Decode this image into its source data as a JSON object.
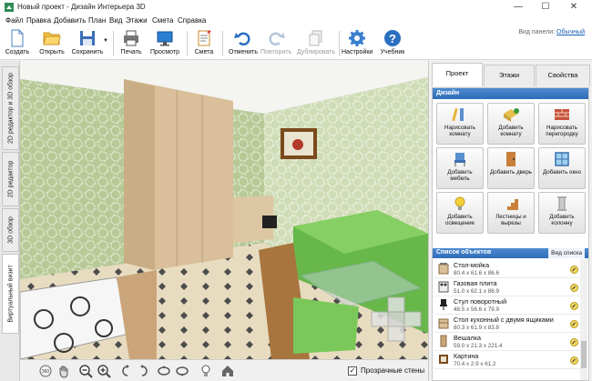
{
  "window": {
    "title": "Новый проект - Дизайн Интерьера 3D",
    "minimize": "—",
    "maximize": "☐",
    "close": "✕"
  },
  "menu": [
    "Файл",
    "Правка",
    "Добавить",
    "План",
    "Вид",
    "Этажи",
    "Смета",
    "Справка"
  ],
  "toolbar": {
    "buttons": [
      {
        "label": "Создать",
        "icon": "new-document-icon"
      },
      {
        "label": "Открыть",
        "icon": "folder-open-icon"
      },
      {
        "label": "Сохранить",
        "icon": "floppy-save-icon"
      },
      {
        "label": "Печать",
        "icon": "printer-icon"
      },
      {
        "label": "Просмотр",
        "icon": "monitor-preview-icon"
      },
      {
        "label": "Смета",
        "icon": "estimate-notepad-icon"
      },
      {
        "label": "Отменить",
        "icon": "undo-icon"
      },
      {
        "label": "Повторить",
        "icon": "redo-icon",
        "disabled": true
      },
      {
        "label": "Дублировать",
        "icon": "duplicate-icon",
        "disabled": true
      },
      {
        "label": "Настройки",
        "icon": "gear-icon"
      },
      {
        "label": "Учебник",
        "icon": "help-icon"
      }
    ],
    "view_panel_label": "Вид панели:",
    "view_panel_value": "Обычный"
  },
  "left_tabs": [
    "2D редактор и 3D обзор",
    "2D редактор",
    "3D обзор",
    "Виртуальный визит"
  ],
  "right_panel": {
    "tabs": [
      "Проект",
      "Этажи",
      "Свойства"
    ],
    "design_header": "Дизайн",
    "design_buttons": [
      {
        "label": "Нарисовать комнату",
        "icon": "pencil-ruler-icon"
      },
      {
        "label": "Добавить комнату",
        "icon": "add-room-icon"
      },
      {
        "label": "Нарисовать перегородку",
        "icon": "brick-wall-icon"
      },
      {
        "label": "Добавить мебель",
        "icon": "chair-icon"
      },
      {
        "label": "Добавить дверь",
        "icon": "door-icon"
      },
      {
        "label": "Добавить окно",
        "icon": "window-icon"
      },
      {
        "label": "Добавить освещение",
        "icon": "lightbulb-icon"
      },
      {
        "label": "Лестницы и вырезы",
        "icon": "stairs-icon"
      },
      {
        "label": "Добавить колонну",
        "icon": "column-icon"
      }
    ],
    "objects_header": "Список объектов",
    "objects_view_label": "Вид списка",
    "objects": [
      {
        "name": "Стол-мойка",
        "dims": "80.4 x 61.6 x 86.6"
      },
      {
        "name": "Газовая плита",
        "dims": "51.0 x 62.1 x 86.9"
      },
      {
        "name": "Стул поворотный",
        "dims": "48.5 x 56.6 x 79.9"
      },
      {
        "name": "Стол кухонный с двумя ящиками",
        "dims": "80.3 x 61.9 x 83.8"
      },
      {
        "name": "Вешалка",
        "dims": "59.0 x 21.3 x 221.4"
      },
      {
        "name": "Картина",
        "dims": "70.4 x 2.9 x 61.2"
      }
    ]
  },
  "bottom_bar": {
    "checkbox_checked": "✓",
    "transparent_walls_label": "Прозрачные стены",
    "buttons": [
      "360-view-icon",
      "hand-pan-icon",
      "zoom-out-icon",
      "zoom-in-icon",
      "orbit-left-icon",
      "orbit-right-icon",
      "tilt-up-icon",
      "tilt-down-icon",
      "lightbulb-icon",
      "home-icon"
    ]
  }
}
